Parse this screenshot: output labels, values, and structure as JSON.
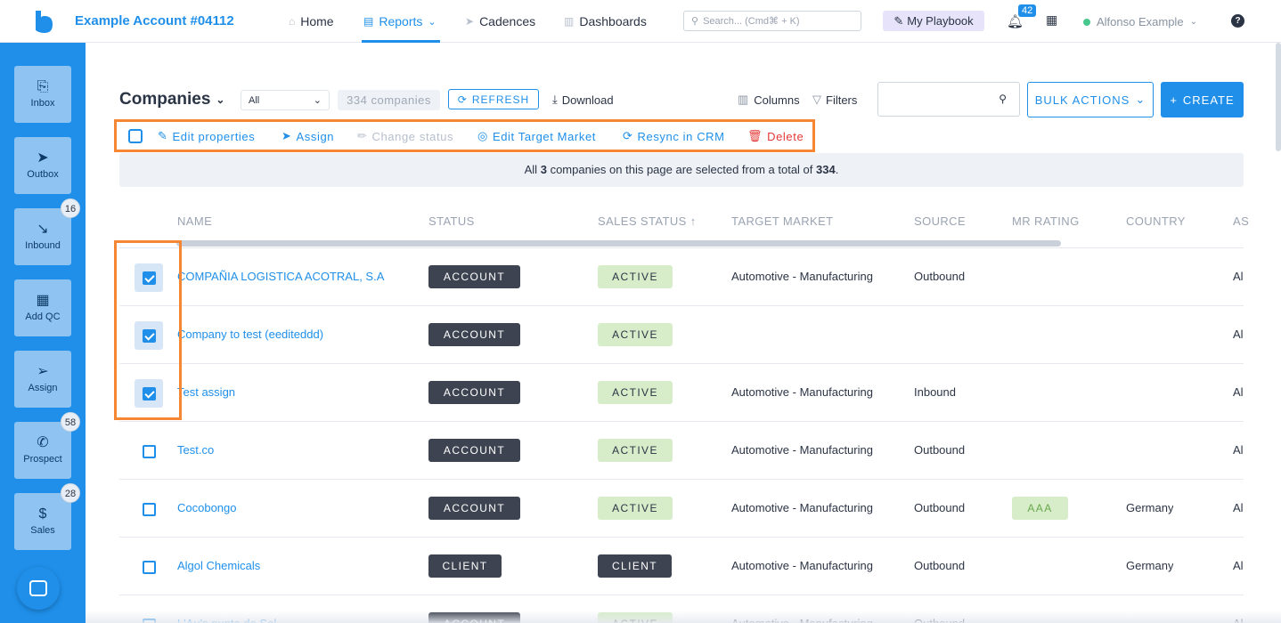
{
  "header": {
    "account_title": "Example Account #04112",
    "nav": [
      {
        "label": "Home",
        "icon": "home-icon"
      },
      {
        "label": "Reports",
        "icon": "reports-icon",
        "active": true
      },
      {
        "label": "Cadences",
        "icon": "cadences-icon"
      },
      {
        "label": "Dashboards",
        "icon": "dashboards-icon"
      }
    ],
    "search_placeholder": "Search... (Cmd⌘ + K)",
    "playbook_label": "My Playbook",
    "notifications_count": "42",
    "user_name": "Alfonso Example",
    "help_label": "?"
  },
  "sidebar": {
    "items": [
      {
        "label": "Inbox",
        "icon": "inbox-icon",
        "badge": ""
      },
      {
        "label": "Outbox",
        "icon": "outbox-icon",
        "badge": ""
      },
      {
        "label": "Inbound",
        "icon": "inbound-icon",
        "badge": "16"
      },
      {
        "label": "Add QC",
        "icon": "building-icon",
        "badge": ""
      },
      {
        "label": "Assign",
        "icon": "assign-icon",
        "badge": ""
      },
      {
        "label": "Prospect",
        "icon": "phone-icon",
        "badge": "58"
      },
      {
        "label": "Sales",
        "icon": "dollar-icon",
        "badge": "28"
      }
    ]
  },
  "toolbar": {
    "title": "Companies",
    "filter_value": "All",
    "count_label": "334 companies",
    "refresh_label": "REFRESH",
    "download_label": "Download",
    "columns_label": "Columns",
    "filters_label": "Filters",
    "search_value": "",
    "bulk_actions_label": "BULK ACTIONS",
    "create_label": "CREATE"
  },
  "bulk_bar": {
    "actions": [
      {
        "label": "Edit properties",
        "icon": "edit-icon",
        "state": "enabled"
      },
      {
        "label": "Assign",
        "icon": "send-icon",
        "state": "enabled"
      },
      {
        "label": "Change status",
        "icon": "pencil-icon",
        "state": "disabled"
      },
      {
        "label": "Edit Target Market",
        "icon": "target-icon",
        "state": "enabled"
      },
      {
        "label": "Resync in CRM",
        "icon": "sync-icon",
        "state": "enabled"
      },
      {
        "label": "Delete",
        "icon": "trash-icon",
        "state": "danger"
      }
    ]
  },
  "selection_banner": {
    "prefix": "All",
    "selected": "3",
    "middle": "companies on this page are selected from a total of",
    "total": "334",
    "suffix": "."
  },
  "table": {
    "columns": [
      "NAME",
      "STATUS",
      "SALES STATUS",
      "TARGET MARKET",
      "SOURCE",
      "MR RATING",
      "COUNTRY",
      "AS"
    ],
    "sort_indicator": "↑",
    "rows": [
      {
        "selected": true,
        "name": "COMPAÑIA LOGISTICA ACOTRAL, S.A",
        "status": "ACCOUNT",
        "sales_status": "ACTIVE",
        "target_market": "Automotive - Manufacturing",
        "source": "Outbound",
        "mr_rating": "",
        "country": "",
        "assignee": "Al"
      },
      {
        "selected": true,
        "name": "Company to test (eediteddd)",
        "status": "ACCOUNT",
        "sales_status": "ACTIVE",
        "target_market": "",
        "source": "",
        "mr_rating": "",
        "country": "",
        "assignee": "Al"
      },
      {
        "selected": true,
        "name": "Test assign",
        "status": "ACCOUNT",
        "sales_status": "ACTIVE",
        "target_market": "Automotive - Manufacturing",
        "source": "Inbound",
        "mr_rating": "",
        "country": "",
        "assignee": "Al"
      },
      {
        "selected": false,
        "name": "Test.co",
        "status": "ACCOUNT",
        "sales_status": "ACTIVE",
        "target_market": "Automotive - Manufacturing",
        "source": "Outbound",
        "mr_rating": "",
        "country": "",
        "assignee": "Al"
      },
      {
        "selected": false,
        "name": "Cocobongo",
        "status": "ACCOUNT",
        "sales_status": "ACTIVE",
        "target_market": "Automotive - Manufacturing",
        "source": "Outbound",
        "mr_rating": "AAA",
        "country": "Germany",
        "assignee": "Al"
      },
      {
        "selected": false,
        "name": "Algol Chemicals",
        "status": "CLIENT",
        "sales_status": "CLIENT",
        "target_market": "Automotive - Manufacturing",
        "source": "Outbound",
        "mr_rating": "",
        "country": "Germany",
        "assignee": "Al"
      },
      {
        "selected": false,
        "name": "L'Au's punto de Sal",
        "status": "ACCOUNT",
        "sales_status": "ACTIVE",
        "target_market": "Automotive - Manufacturing",
        "source": "Outbound",
        "mr_rating": "",
        "country": "",
        "assignee": "Al"
      }
    ]
  },
  "colors": {
    "primary": "#1f8fe9",
    "highlight": "#f58634",
    "dark_pill": "#3d4350",
    "green_pill": "#d7edc9",
    "danger": "#e53935"
  }
}
